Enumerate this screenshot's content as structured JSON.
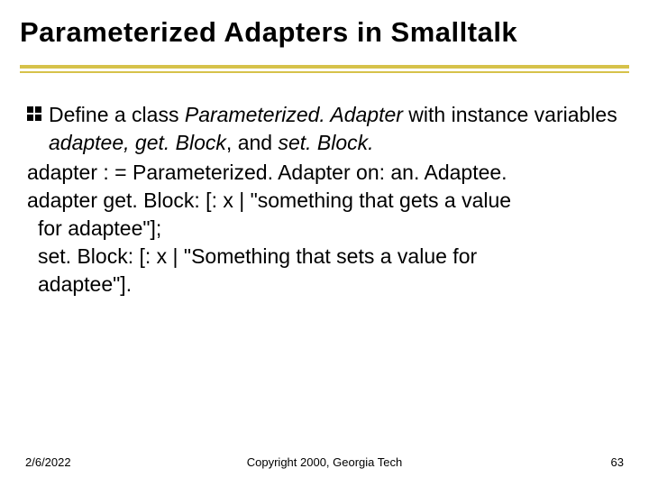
{
  "title": "Parameterized Adapters in Smalltalk",
  "bullet": {
    "pre": "Define a class ",
    "em1": "Parameterized. Adapter",
    "mid1": " with instance variables ",
    "em2": "adaptee, get. Block",
    "mid2": ", and ",
    "em3": "set. Block.",
    "post": ""
  },
  "lines": {
    "l1": "adapter : = Parameterized. Adapter on: an. Adaptee.",
    "l2a": "adapter get. Block: [: x | \"something that gets a value",
    "l2b": "for adaptee\"];",
    "l3a": "set. Block: [: x | \"Something that sets a value for",
    "l3b": "adaptee\"]."
  },
  "footer": {
    "date": "2/6/2022",
    "copyright": "Copyright 2000, Georgia Tech",
    "page": "63"
  }
}
